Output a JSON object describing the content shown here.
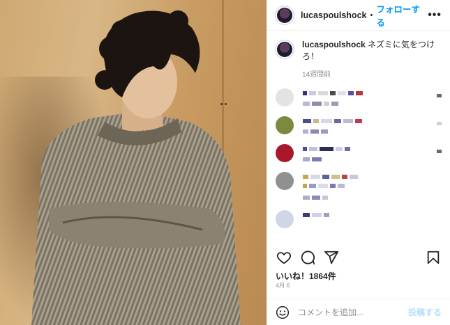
{
  "post": {
    "photo_alt": "",
    "username": "lucaspoulshock",
    "separator": "•",
    "follow_label": "フォローする",
    "more_label": "•••",
    "caption_text": "ネズミに気をつけろ！",
    "caption_time": "14週間前",
    "likes": "いいね！1864件",
    "date": "4月 6",
    "comment_placeholder": "コメントを追加...",
    "post_label": "投稿する"
  },
  "colors": {
    "accent": "#0095f6",
    "post_disabled": "#b2dffc",
    "muted": "#8e8e8e"
  },
  "icons": [
    "more-options-icon",
    "heart-icon",
    "comment-icon",
    "share-icon",
    "bookmark-icon",
    "emoji-icon"
  ]
}
